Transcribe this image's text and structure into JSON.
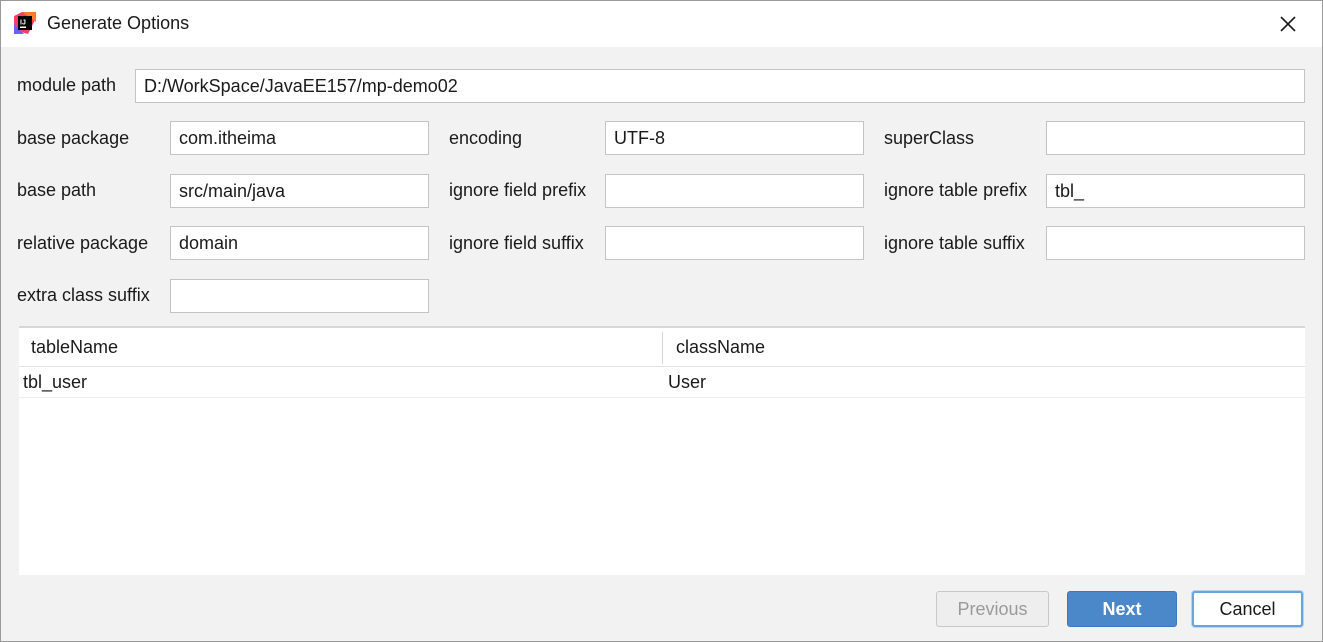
{
  "window": {
    "title": "Generate Options",
    "app_icon": "intellij-idea-icon",
    "close_icon": "close-icon"
  },
  "form": {
    "module_path": {
      "label": "module path",
      "value": "D:/WorkSpace/JavaEE157/mp-demo02"
    },
    "base_package": {
      "label": "base package",
      "value": "com.itheima"
    },
    "encoding": {
      "label": "encoding",
      "value": "UTF-8"
    },
    "super_class": {
      "label": "superClass",
      "value": ""
    },
    "base_path": {
      "label": "base path",
      "value": "src/main/java"
    },
    "ignore_field_prefix": {
      "label": "ignore field prefix",
      "value": ""
    },
    "ignore_table_prefix": {
      "label": "ignore table prefix",
      "value": "tbl_"
    },
    "relative_package": {
      "label": "relative package",
      "value": "domain"
    },
    "ignore_field_suffix": {
      "label": "ignore field suffix",
      "value": ""
    },
    "ignore_table_suffix": {
      "label": "ignore table suffix",
      "value": ""
    },
    "extra_class_suffix": {
      "label": "extra class suffix",
      "value": ""
    }
  },
  "table": {
    "columns": [
      "tableName",
      "className"
    ],
    "rows": [
      [
        "tbl_user",
        "User"
      ]
    ]
  },
  "buttons": {
    "previous": "Previous",
    "next": "Next",
    "cancel": "Cancel"
  },
  "colors": {
    "primary_button": "#4a88c9",
    "focus_ring": "#6aa4dc"
  }
}
